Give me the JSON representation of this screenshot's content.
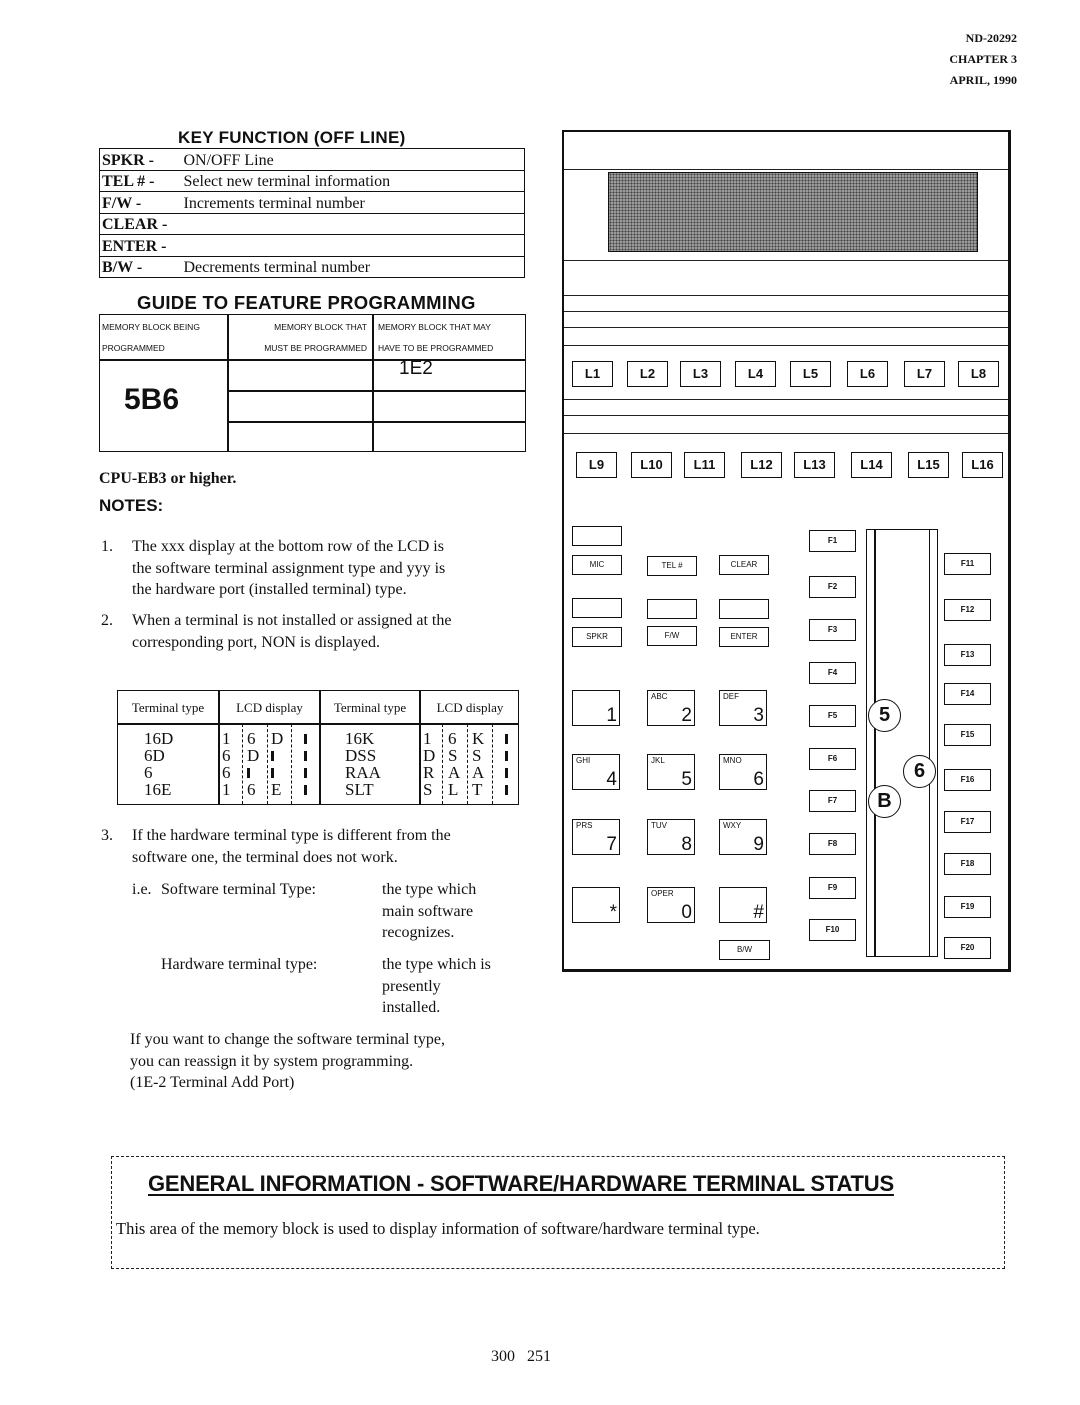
{
  "header": {
    "doc_number": "ND-20292",
    "chapter": "CHAPTER 3",
    "date": "APRIL, 1990"
  },
  "key_function": {
    "title": "KEY FUNCTION (OFF LINE)",
    "rows": [
      {
        "key": "SPKR -",
        "desc": "ON/OFF Line"
      },
      {
        "key": "TEL # -",
        "desc": "Select new terminal information"
      },
      {
        "key": "F/W -",
        "desc": "Increments terminal number"
      },
      {
        "key": "CLEAR -",
        "desc": ""
      },
      {
        "key": "ENTER -",
        "desc": ""
      },
      {
        "key": "B/W -",
        "desc": "Decrements terminal number"
      }
    ]
  },
  "guide": {
    "title": "GUIDE TO FEATURE PROGRAMMING",
    "col1_header": [
      "MEMORY BLOCK BEING",
      "PROGRAMMED"
    ],
    "col2_header": [
      "MEMORY BLOCK THAT",
      "MUST BE PROGRAMMED"
    ],
    "col3_header": [
      "MEMORY BLOCK THAT MAY",
      "HAVE TO BE PROGRAMMED"
    ],
    "block_programmed": "5B6",
    "may_program": [
      "1E2",
      "",
      ""
    ],
    "must_program": [
      "",
      "",
      ""
    ]
  },
  "cpu_requirement": "CPU-EB3 or higher.",
  "notes": {
    "heading": "NOTES:",
    "items": [
      {
        "num": "1.",
        "lines": [
          "The xxx display at the bottom row of the LCD is",
          "the software terminal assignment type and yyy is",
          "the hardware port (installed terminal) type."
        ]
      },
      {
        "num": "2.",
        "lines": [
          "When a terminal is not installed or assigned at the",
          "corresponding port, NON is displayed."
        ]
      },
      {
        "num": "3.",
        "lines": [
          "If the hardware terminal type is different from the",
          "software one, the terminal does not work."
        ]
      }
    ],
    "ie_label": "i.e.",
    "software_label": "Software terminal Type:",
    "software_desc": [
      "the type  which",
      "main software",
      "recognizes."
    ],
    "hardware_label": "Hardware terminal type:",
    "hardware_desc": [
      "the type which is",
      "presently",
      "installed."
    ],
    "closing": [
      "If you want to change the software terminal type,",
      "you can reassign it by system programming.",
      "(1E-2 Terminal Add Port)"
    ]
  },
  "terminal_table": {
    "headers": [
      "Terminal type",
      "LCD display",
      "Terminal type",
      "LCD display"
    ],
    "left": [
      {
        "type": "16D",
        "lcd": [
          "1",
          "6",
          "D",
          "▮"
        ]
      },
      {
        "type": "6D",
        "lcd": [
          "6",
          "D",
          "▮",
          "▮"
        ]
      },
      {
        "type": "6",
        "lcd": [
          "6",
          "▮",
          "▮",
          "▮"
        ]
      },
      {
        "type": "16E",
        "lcd": [
          "1",
          "6",
          "E",
          "▮"
        ]
      }
    ],
    "right": [
      {
        "type": "16K",
        "lcd": [
          "1",
          "6",
          "K",
          "▮"
        ]
      },
      {
        "type": "DSS",
        "lcd": [
          "D",
          "S",
          "S",
          "▮"
        ]
      },
      {
        "type": "RAA",
        "lcd": [
          "R",
          "A",
          "A",
          "▮"
        ]
      },
      {
        "type": "SLT",
        "lcd": [
          "S",
          "L",
          "T",
          "▮"
        ]
      }
    ]
  },
  "phone": {
    "line_keys_row1": [
      "L1",
      "L2",
      "L3",
      "L4",
      "L5",
      "L6",
      "L7",
      "L8"
    ],
    "line_keys_row2": [
      "L9",
      "L10",
      "L11",
      "L12",
      "L13",
      "L14",
      "L15",
      "L16"
    ],
    "mic": "MIC",
    "tel": "TEL #",
    "clear": "CLEAR",
    "spkr": "SPKR",
    "fw": "F/W",
    "enter": "ENTER",
    "bw": "B/W",
    "dialpad": [
      {
        "letters": "",
        "digit": "1"
      },
      {
        "letters": "ABC",
        "digit": "2"
      },
      {
        "letters": "DEF",
        "digit": "3"
      },
      {
        "letters": "GHI",
        "digit": "4"
      },
      {
        "letters": "JKL",
        "digit": "5"
      },
      {
        "letters": "MNO",
        "digit": "6"
      },
      {
        "letters": "PRS",
        "digit": "7"
      },
      {
        "letters": "TUV",
        "digit": "8"
      },
      {
        "letters": "WXY",
        "digit": "9"
      },
      {
        "letters": "",
        "digit": "*"
      },
      {
        "letters": "OPER",
        "digit": "0"
      },
      {
        "letters": "",
        "digit": "#"
      }
    ],
    "f_left": [
      "F1",
      "F2",
      "F3",
      "F4",
      "F5",
      "F6",
      "F7",
      "F8",
      "F9",
      "F10"
    ],
    "f_right": [
      "F11",
      "F12",
      "F13",
      "F14",
      "F15",
      "F16",
      "F17",
      "F18",
      "F19",
      "F20"
    ],
    "callout_5": "5",
    "callout_6": "6",
    "callout_b": "B"
  },
  "general_info": {
    "title": "GENERAL INFORMATION  -  SOFTWARE/HARDWARE TERMINAL STATUS",
    "body": "This area of the memory block is used to display information of software/hardware terminal type."
  },
  "page_number": "300 251"
}
